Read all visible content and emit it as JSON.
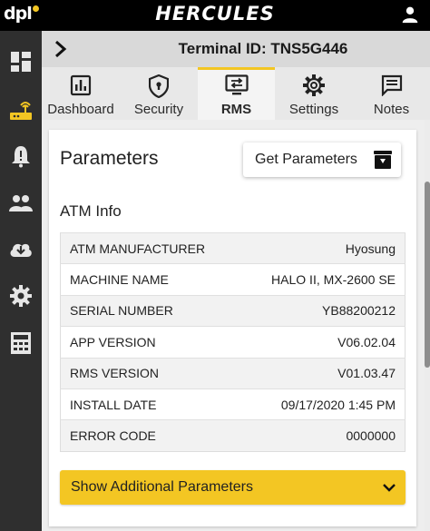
{
  "topbar": {
    "logo": "dpl",
    "brand": "HERCULES",
    "user_icon": "person-icon"
  },
  "sidebar": {
    "items": [
      {
        "icon": "dashboard-grid-icon",
        "active": false
      },
      {
        "icon": "router-icon",
        "active": true
      },
      {
        "icon": "alert-bell-icon",
        "active": false
      },
      {
        "icon": "people-icon",
        "active": false
      },
      {
        "icon": "cloud-download-icon",
        "active": false
      },
      {
        "icon": "gear-icon",
        "active": false
      },
      {
        "icon": "calculator-icon",
        "active": false
      }
    ]
  },
  "header": {
    "terminal_label": "Terminal ID: TNS5G446",
    "back_icon": "chevron-right-icon"
  },
  "tabs": [
    {
      "label": "Dashboard",
      "icon": "bar-chart-icon",
      "active": false
    },
    {
      "label": "Security",
      "icon": "shield-icon",
      "active": false
    },
    {
      "label": "RMS",
      "icon": "monitor-transfer-icon",
      "active": true
    },
    {
      "label": "Settings",
      "icon": "gear-icon",
      "active": false
    },
    {
      "label": "Notes",
      "icon": "notes-icon",
      "active": false
    }
  ],
  "parameters": {
    "title": "Parameters",
    "get_button_label": "Get Parameters",
    "section_title": "ATM Info",
    "rows": [
      {
        "label": "ATM MANUFACTURER",
        "value": "Hyosung"
      },
      {
        "label": "MACHINE NAME",
        "value": "HALO II, MX-2600 SE"
      },
      {
        "label": "SERIAL NUMBER",
        "value": "YB88200212"
      },
      {
        "label": "APP VERSION",
        "value": "V06.02.04"
      },
      {
        "label": "RMS VERSION",
        "value": "V01.03.47"
      },
      {
        "label": "INSTALL DATE",
        "value": "09/17/2020 1:45 PM"
      },
      {
        "label": "ERROR CODE",
        "value": "0000000"
      }
    ],
    "more_label": "Show Additional Parameters"
  },
  "colors": {
    "accent": "#f3c623",
    "sidebar_bg": "#2f2f2f",
    "topbar_bg": "#000000"
  }
}
